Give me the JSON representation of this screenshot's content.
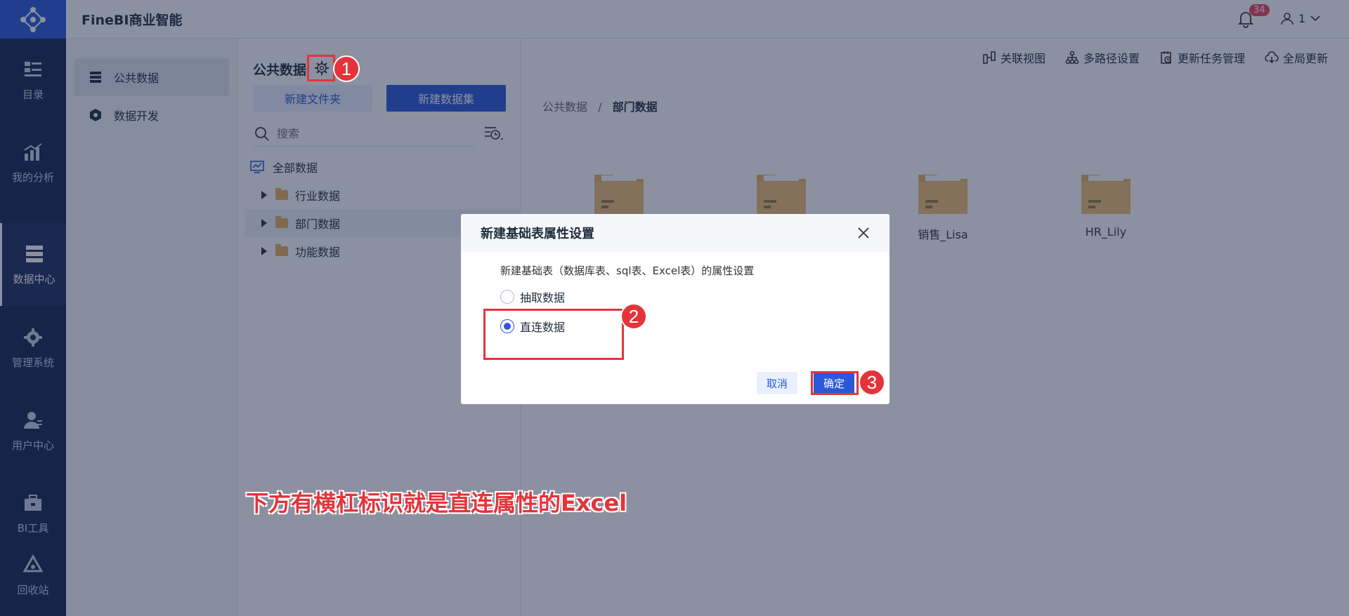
{
  "app": {
    "title": "FineBI商业智能",
    "notification_count": "34",
    "user_name": "1"
  },
  "rail": {
    "items": [
      {
        "label": "目录",
        "icon": "catalog-icon"
      },
      {
        "label": "我的分析",
        "icon": "analysis-icon"
      },
      {
        "label": "数据中心",
        "icon": "data-center-icon",
        "active": true
      },
      {
        "label": "管理系统",
        "icon": "gear-icon"
      },
      {
        "label": "用户中心",
        "icon": "user-icon"
      },
      {
        "label": "BI工具",
        "icon": "toolbox-icon"
      },
      {
        "label": "回收站",
        "icon": "recycle-icon"
      }
    ]
  },
  "subnav": {
    "items": [
      {
        "label": "公共数据",
        "active": true
      },
      {
        "label": "数据开发"
      }
    ]
  },
  "tree": {
    "title": "公共数据",
    "new_folder": "新建文件夹",
    "new_dataset": "新建数据集",
    "search_placeholder": "搜索",
    "root": "全部数据",
    "nodes": [
      {
        "label": "行业数据"
      },
      {
        "label": "部门数据",
        "selected": true
      },
      {
        "label": "功能数据"
      }
    ]
  },
  "toolbar": {
    "items": [
      "关联视图",
      "多路径设置",
      "更新任务管理",
      "全局更新"
    ]
  },
  "breadcrumb": {
    "root": "公共数据",
    "separator": "/",
    "current": "部门数据"
  },
  "folders": [
    {
      "label": ""
    },
    {
      "label": ""
    },
    {
      "label": "销售_Lisa"
    },
    {
      "label": "HR_Lily"
    }
  ],
  "dialog": {
    "title": "新建基础表属性设置",
    "description": "新建基础表（数据库表、sql表、Excel表）的属性设置",
    "option_extract": "抽取数据",
    "option_direct": "直连数据",
    "selected": "直连数据",
    "cancel": "取消",
    "confirm": "确定"
  },
  "annotations": {
    "mark1": "1",
    "mark2": "2",
    "mark3": "3",
    "note": "下方有横杠标识就是直连属性的Excel"
  },
  "colors": {
    "brand": "#2b58d8",
    "rail": "#15244f",
    "annotation": "#e4343a",
    "badge": "#e8455a"
  }
}
